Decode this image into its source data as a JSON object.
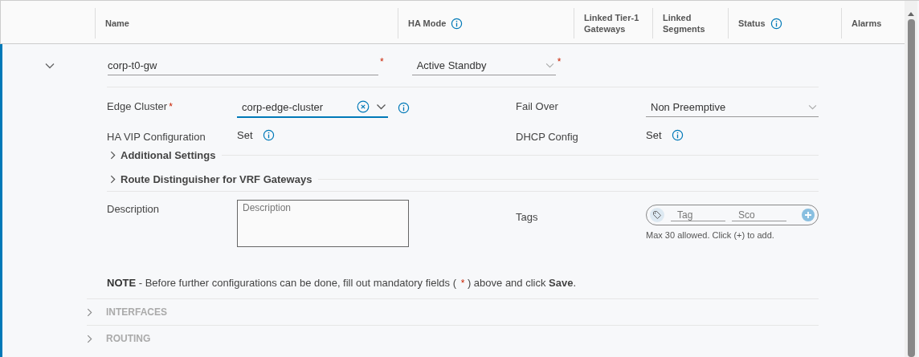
{
  "table": {
    "columns": [
      {
        "label": "Name",
        "info": false
      },
      {
        "label": "HA Mode",
        "info": true
      },
      {
        "label": "Linked Tier-1 Gateways",
        "info": false
      },
      {
        "label": "Linked Segments",
        "info": false
      },
      {
        "label": "Status",
        "info": true
      },
      {
        "label": "Alarms",
        "info": false
      }
    ]
  },
  "row": {
    "expanded": true,
    "name": {
      "value": "corp-t0-gw",
      "required": true
    },
    "ha_mode": {
      "value": "Active Standby",
      "required": true
    }
  },
  "form": {
    "left": [
      {
        "kind": "select",
        "label": "Edge Cluster",
        "required": true,
        "value": "corp-edge-cluster"
      },
      {
        "kind": "set",
        "label": "HA VIP Configuration",
        "required": false,
        "value": "Set"
      }
    ],
    "right": [
      {
        "kind": "select",
        "label": "Fail Over",
        "required": false,
        "value": "Non Preemptive"
      },
      {
        "kind": "set",
        "label": "DHCP Config",
        "required": false,
        "value": "Set"
      }
    ],
    "sections": [
      {
        "label": "Additional Settings",
        "expanded": false
      },
      {
        "label": "Route Distinguisher for VRF Gateways",
        "expanded": false
      }
    ],
    "description": {
      "label": "Description",
      "placeholder": "Description"
    },
    "tags": {
      "label": "Tags",
      "tag_placeholder": "Tag",
      "scope_placeholder": "Sco",
      "hint": "Max 30 allowed. Click (+) to add."
    },
    "note": {
      "lead": "NOTE",
      "text": "- Before further configurations can be done, fill out mandatory fields (",
      "marker": "*",
      "tail": ") above and click **Save**."
    }
  },
  "panels": [
    {
      "label": "INTERFACES",
      "disabled": true
    },
    {
      "label": "ROUTING",
      "disabled": true
    }
  ]
}
